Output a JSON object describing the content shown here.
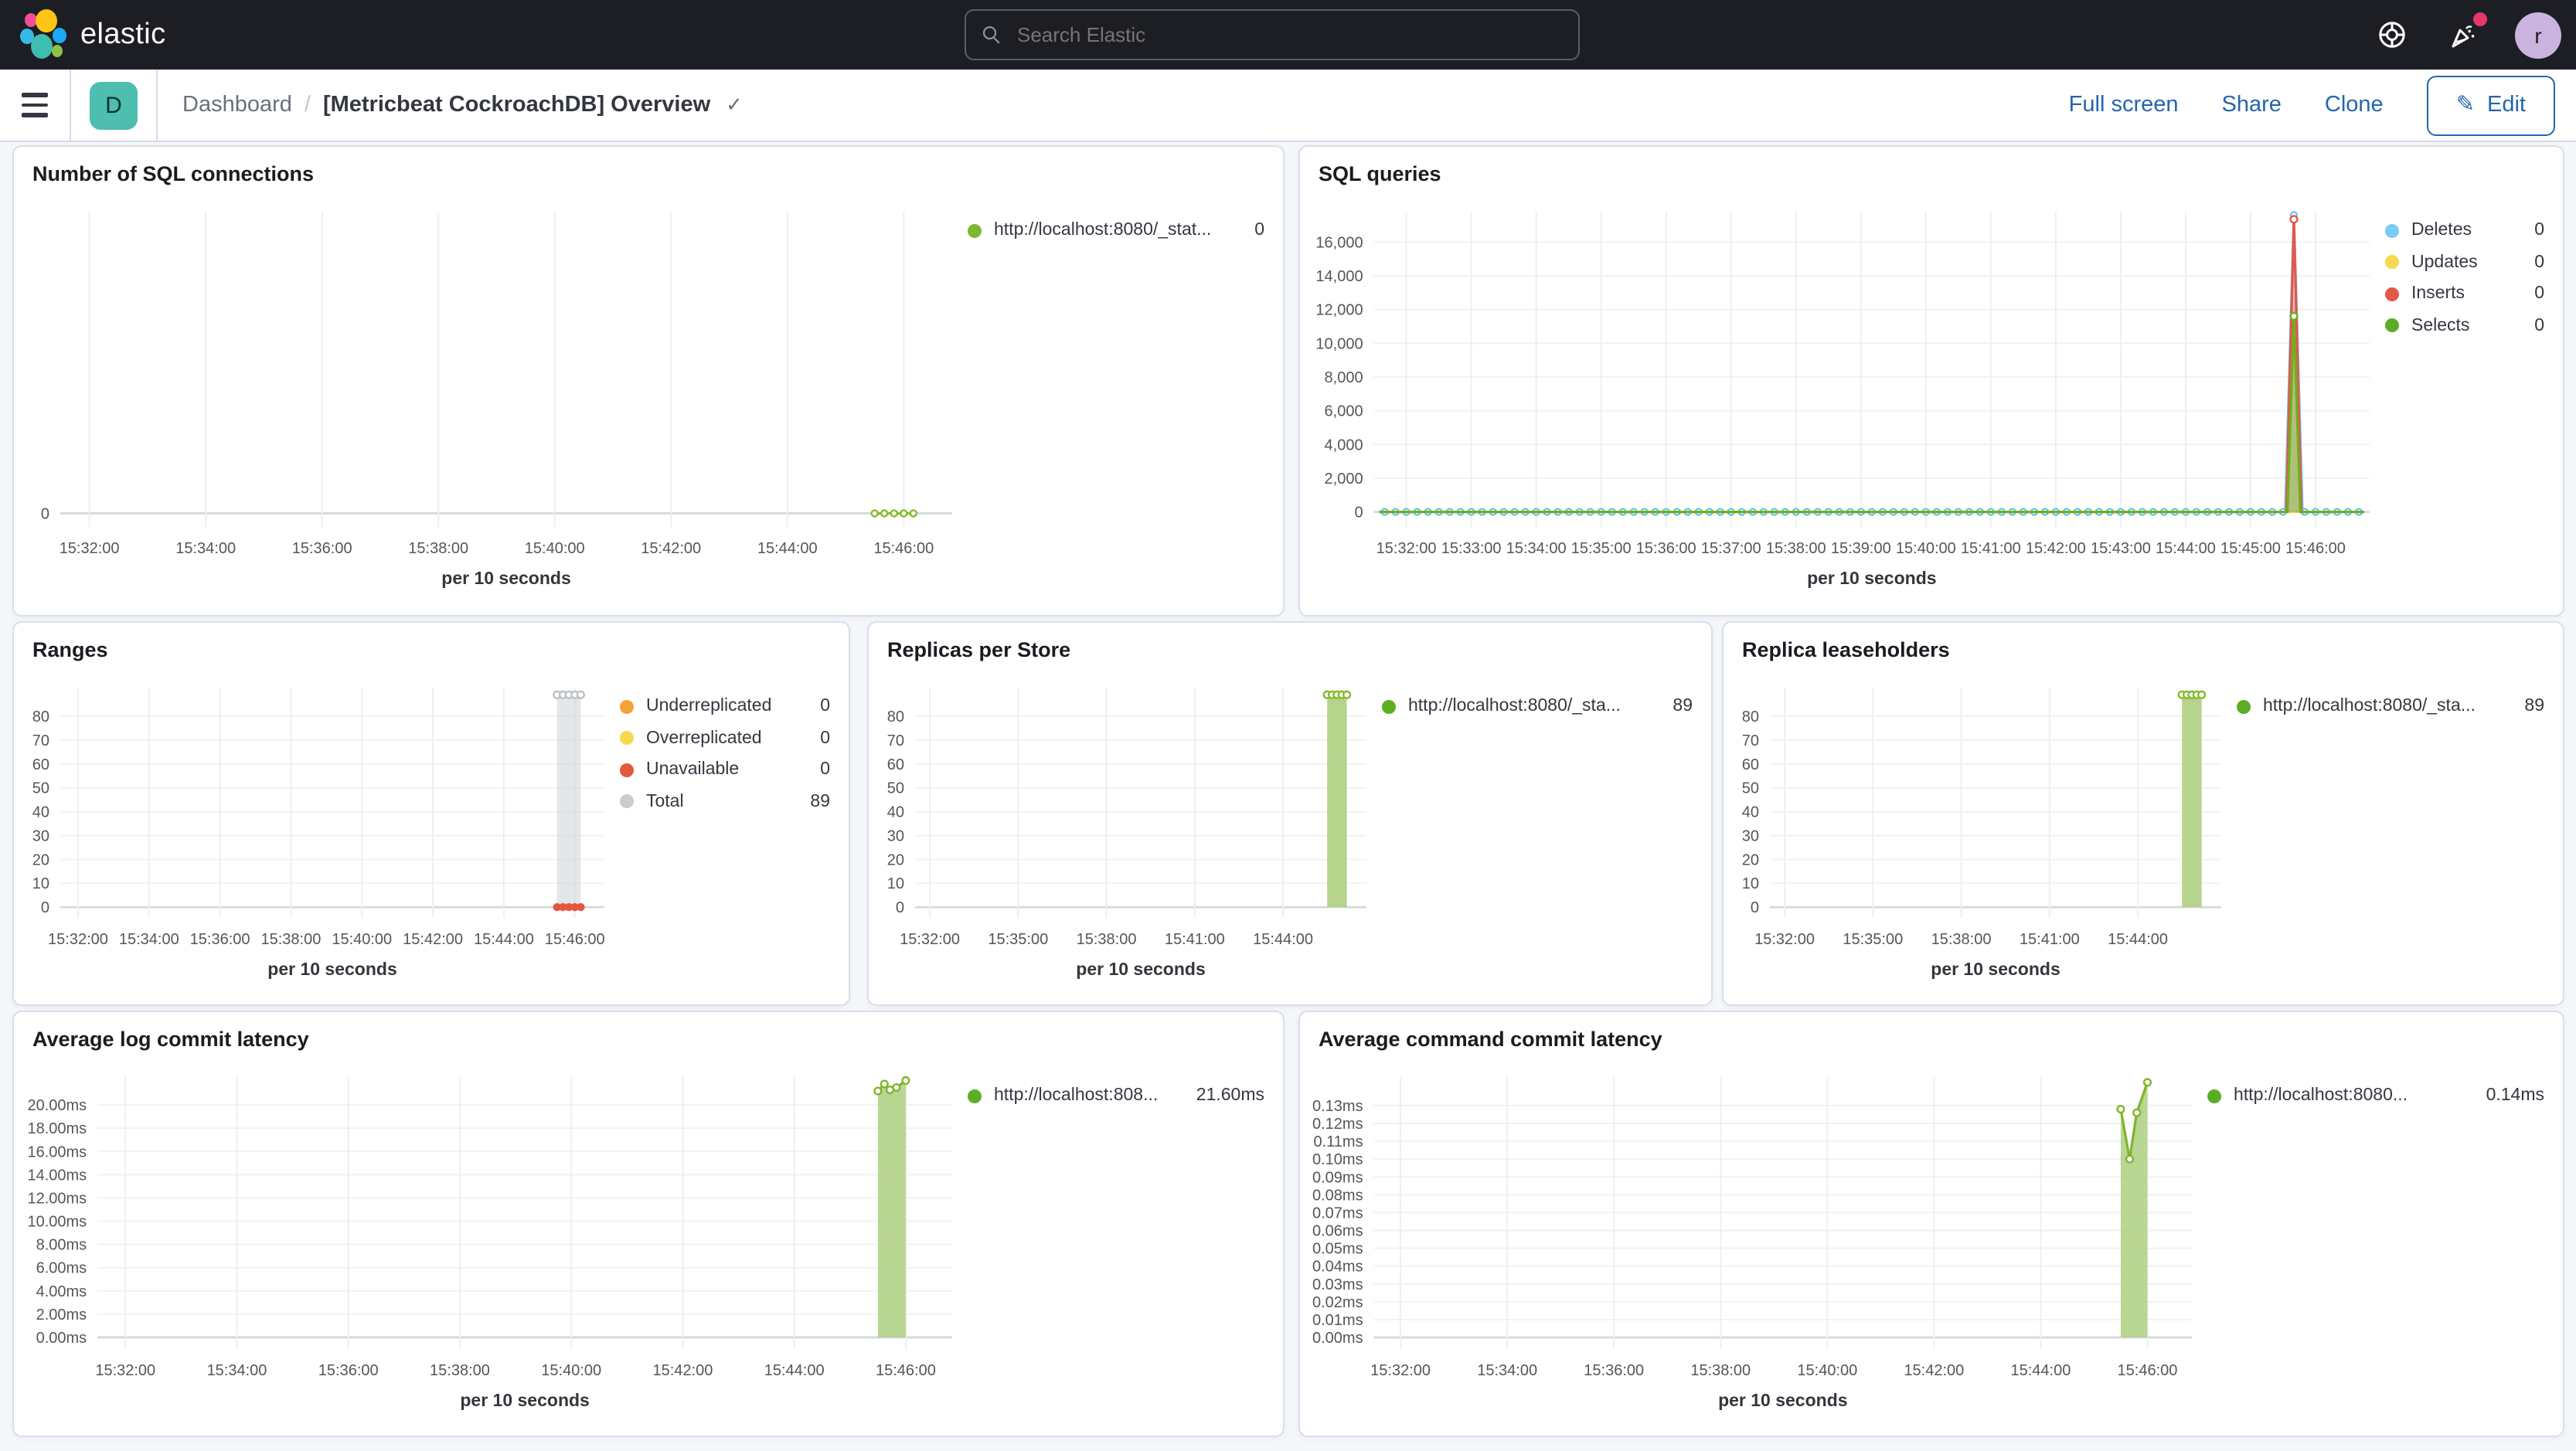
{
  "header": {
    "logo_text": "elastic",
    "search_placeholder": "Search Elastic",
    "help_icon": "lifebuoy-icon",
    "news_icon": "party-popper-icon",
    "avatar_letter": "r"
  },
  "toolbar": {
    "space_badge": "D",
    "breadcrumb_root": "Dashboard",
    "breadcrumb_sep": "/",
    "title": "[Metricbeat CockroachDB] Overview",
    "check_glyph": "✓",
    "actions": [
      "Full screen",
      "Share",
      "Clone"
    ],
    "edit_label": "Edit",
    "edit_icon_glyph": "✎"
  },
  "charts": [
    {
      "type": "line",
      "title": "Number of SQL connections",
      "x_axis": {
        "start": "15:31:30",
        "end": "15:46:50",
        "ticks": [
          "15:32:00",
          "15:34:00",
          "15:36:00",
          "15:38:00",
          "15:40:00",
          "15:42:00",
          "15:44:00",
          "15:46:00"
        ],
        "label": "per 10 seconds"
      },
      "y_axis": {
        "min": -0.045,
        "max": 1,
        "ticks": [
          {
            "v": 0,
            "label": "0"
          }
        ]
      },
      "series": [
        {
          "name": "http://localhost:8080/_stat...",
          "type": "line",
          "color": "#86BB2D",
          "points": [
            [
              "15:45:30",
              0
            ],
            [
              "15:46:10",
              0
            ]
          ],
          "markers": {
            "interval": 10,
            "from": "15:45:30",
            "to": "15:46:10"
          }
        }
      ],
      "legend": [
        {
          "label": "http://localhost:8080/_stat...",
          "value": "0",
          "color": "#7FB733"
        }
      ]
    },
    {
      "type": "area",
      "title": "SQL queries",
      "x_axis": {
        "start": "15:31:30",
        "end": "15:46:50",
        "ticks": [
          "15:32:00",
          "15:33:00",
          "15:34:00",
          "15:35:00",
          "15:36:00",
          "15:37:00",
          "15:38:00",
          "15:39:00",
          "15:40:00",
          "15:41:00",
          "15:42:00",
          "15:43:00",
          "15:44:00",
          "15:45:00",
          "15:46:00"
        ],
        "label": "per 10 seconds"
      },
      "y_axis": {
        "min": -890,
        "max": 17800,
        "ticks": [
          {
            "v": 0,
            "label": "0"
          },
          {
            "v": 2000,
            "label": "2,000"
          },
          {
            "v": 4000,
            "label": "4,000"
          },
          {
            "v": 6000,
            "label": "6,000"
          },
          {
            "v": 8000,
            "label": "8,000"
          },
          {
            "v": 10000,
            "label": "10,000"
          },
          {
            "v": 12000,
            "label": "12,000"
          },
          {
            "v": 14000,
            "label": "14,000"
          },
          {
            "v": 16000,
            "label": "16,000"
          }
        ]
      },
      "series": [
        {
          "name": "Updates",
          "type": "line",
          "color": "#F1D550",
          "points": [
            [
              "15:31:35",
              0
            ],
            [
              "15:46:45",
              0
            ]
          ]
        },
        {
          "name": "Deletes",
          "type": "area",
          "color": "#6EC7EC",
          "fill": "rgba(110,199,236,0.28)",
          "points": [
            [
              "15:31:35",
              0
            ],
            [
              "15:45:32",
              0
            ],
            [
              "15:45:40",
              17600
            ],
            [
              "15:45:48",
              0
            ],
            [
              "15:46:45",
              0
            ]
          ],
          "markers": {
            "interval": 10,
            "from": "15:31:40",
            "to": "15:46:40"
          }
        },
        {
          "name": "Inserts",
          "type": "area",
          "color": "#E4574C",
          "fill": "rgba(228,87,76,0.30)",
          "points": [
            [
              "15:31:35",
              0
            ],
            [
              "15:45:33",
              0
            ],
            [
              "15:45:40",
              17350
            ],
            [
              "15:45:47",
              0
            ],
            [
              "15:46:45",
              0
            ]
          ],
          "markers": "peaks"
        },
        {
          "name": "Selects",
          "type": "area",
          "color": "#6FAF1F",
          "fill": "rgba(140,190,60,0.55)",
          "points": [
            [
              "15:31:35",
              0
            ],
            [
              "15:45:34",
              0
            ],
            [
              "15:45:40",
              11600
            ],
            [
              "15:45:46",
              0
            ],
            [
              "15:46:45",
              0
            ]
          ],
          "markers": "peaks"
        }
      ],
      "legend": [
        {
          "label": "Deletes",
          "value": "0",
          "color": "#79CBF0"
        },
        {
          "label": "Updates",
          "value": "0",
          "color": "#F5D94F"
        },
        {
          "label": "Inserts",
          "value": "0",
          "color": "#E4574C"
        },
        {
          "label": "Selects",
          "value": "0",
          "color": "#5BAE23"
        }
      ]
    },
    {
      "type": "bar",
      "title": "Ranges",
      "x_axis": {
        "start": "15:31:30",
        "end": "15:46:50",
        "ticks": [
          "15:32:00",
          "15:34:00",
          "15:36:00",
          "15:38:00",
          "15:40:00",
          "15:42:00",
          "15:44:00",
          "15:46:00"
        ],
        "label": "per 10 seconds"
      },
      "y_axis": {
        "min": -4.5,
        "max": 92,
        "ticks": [
          {
            "v": 0,
            "label": "0"
          },
          {
            "v": 10,
            "label": "10"
          },
          {
            "v": 20,
            "label": "20"
          },
          {
            "v": 30,
            "label": "30"
          },
          {
            "v": 40,
            "label": "40"
          },
          {
            "v": 50,
            "label": "50"
          },
          {
            "v": 60,
            "label": "60"
          },
          {
            "v": 70,
            "label": "70"
          },
          {
            "v": 80,
            "label": "80"
          }
        ]
      },
      "series": [
        {
          "name": "Total",
          "type": "bar",
          "color": "#BCC0C6",
          "fill": "rgba(203,206,210,0.5)",
          "from": "15:45:30",
          "to": "15:46:10",
          "value": 89,
          "top_markers": true
        },
        {
          "name": "Unavailable",
          "type": "dots",
          "color": "#E4573D",
          "from": "15:45:30",
          "to": "15:46:10",
          "value": 0
        }
      ],
      "legend": [
        {
          "label": "Underreplicated",
          "value": "0",
          "color": "#F2A23A"
        },
        {
          "label": "Overreplicated",
          "value": "0",
          "color": "#F5D94F"
        },
        {
          "label": "Unavailable",
          "value": "0",
          "color": "#E4573D"
        },
        {
          "label": "Total",
          "value": "89",
          "color": "#C9CCD1"
        }
      ]
    },
    {
      "type": "bar",
      "title": "Replicas per Store",
      "x_axis": {
        "start": "15:31:30",
        "end": "15:46:50",
        "ticks": [
          "15:32:00",
          "15:35:00",
          "15:38:00",
          "15:41:00",
          "15:44:00"
        ],
        "label": "per 10 seconds"
      },
      "y_axis": {
        "min": -4.5,
        "max": 92,
        "ticks": [
          {
            "v": 0,
            "label": "0"
          },
          {
            "v": 10,
            "label": "10"
          },
          {
            "v": 20,
            "label": "20"
          },
          {
            "v": 30,
            "label": "30"
          },
          {
            "v": 40,
            "label": "40"
          },
          {
            "v": 50,
            "label": "50"
          },
          {
            "v": 60,
            "label": "60"
          },
          {
            "v": 70,
            "label": "70"
          },
          {
            "v": 80,
            "label": "80"
          }
        ]
      },
      "series": [
        {
          "name": "http://localhost:8080/_sta...",
          "type": "bar",
          "color": "#86BB2D",
          "fill": "rgba(174,207,128,0.9)",
          "from": "15:45:30",
          "to": "15:46:10",
          "value": 89,
          "top_markers": true
        }
      ],
      "legend": [
        {
          "label": "http://localhost:8080/_sta...",
          "value": "89",
          "color": "#5BAE23"
        }
      ]
    },
    {
      "type": "bar",
      "title": "Replica leaseholders",
      "x_axis": {
        "start": "15:31:30",
        "end": "15:46:50",
        "ticks": [
          "15:32:00",
          "15:35:00",
          "15:38:00",
          "15:41:00",
          "15:44:00"
        ],
        "label": "per 10 seconds"
      },
      "y_axis": {
        "min": -4.5,
        "max": 92,
        "ticks": [
          {
            "v": 0,
            "label": "0"
          },
          {
            "v": 10,
            "label": "10"
          },
          {
            "v": 20,
            "label": "20"
          },
          {
            "v": 30,
            "label": "30"
          },
          {
            "v": 40,
            "label": "40"
          },
          {
            "v": 50,
            "label": "50"
          },
          {
            "v": 60,
            "label": "60"
          },
          {
            "v": 70,
            "label": "70"
          },
          {
            "v": 80,
            "label": "80"
          }
        ]
      },
      "series": [
        {
          "name": "http://localhost:8080/_sta...",
          "type": "bar",
          "color": "#86BB2D",
          "fill": "rgba(174,207,128,0.9)",
          "from": "15:45:30",
          "to": "15:46:10",
          "value": 89,
          "top_markers": true
        }
      ],
      "legend": [
        {
          "label": "http://localhost:8080/_sta...",
          "value": "89",
          "color": "#5BAE23"
        }
      ]
    },
    {
      "type": "area",
      "title": "Average log commit latency",
      "x_axis": {
        "start": "15:31:30",
        "end": "15:46:50",
        "ticks": [
          "15:32:00",
          "15:34:00",
          "15:36:00",
          "15:38:00",
          "15:40:00",
          "15:42:00",
          "15:44:00",
          "15:46:00"
        ],
        "label": "per 10 seconds"
      },
      "y_axis": {
        "min": -1.0,
        "max": 22.4,
        "ticks": [
          {
            "v": 0,
            "label": "0.00ms"
          },
          {
            "v": 2,
            "label": "2.00ms"
          },
          {
            "v": 4,
            "label": "4.00ms"
          },
          {
            "v": 6,
            "label": "6.00ms"
          },
          {
            "v": 8,
            "label": "8.00ms"
          },
          {
            "v": 10,
            "label": "10.00ms"
          },
          {
            "v": 12,
            "label": "12.00ms"
          },
          {
            "v": 14,
            "label": "14.00ms"
          },
          {
            "v": 16,
            "label": "16.00ms"
          },
          {
            "v": 18,
            "label": "18.00ms"
          },
          {
            "v": 20,
            "label": "20.00ms"
          }
        ]
      },
      "series": [
        {
          "name": "http://localhost:808...",
          "type": "area",
          "color": "#7FB62A",
          "fill": "rgba(174,207,128,0.85)",
          "points": [
            [
              "15:45:30",
              21.2
            ],
            [
              "15:45:37",
              21.8
            ],
            [
              "15:45:43",
              21.3
            ],
            [
              "15:45:50",
              21.5
            ],
            [
              "15:46:00",
              22.1
            ]
          ],
          "markers": "all"
        }
      ],
      "legend": [
        {
          "label": "http://localhost:808...",
          "value": "21.60ms",
          "color": "#5BAE23"
        }
      ]
    },
    {
      "type": "area",
      "title": "Average command commit latency",
      "x_axis": {
        "start": "15:31:30",
        "end": "15:46:50",
        "ticks": [
          "15:32:00",
          "15:34:00",
          "15:36:00",
          "15:38:00",
          "15:40:00",
          "15:42:00",
          "15:44:00",
          "15:46:00"
        ],
        "label": "per 10 seconds"
      },
      "y_axis": {
        "min": -0.0065,
        "max": 0.146,
        "ticks": [
          {
            "v": 0,
            "label": "0.00ms"
          },
          {
            "v": 0.01,
            "label": "0.01ms"
          },
          {
            "v": 0.02,
            "label": "0.02ms"
          },
          {
            "v": 0.03,
            "label": "0.03ms"
          },
          {
            "v": 0.04,
            "label": "0.04ms"
          },
          {
            "v": 0.05,
            "label": "0.05ms"
          },
          {
            "v": 0.06,
            "label": "0.06ms"
          },
          {
            "v": 0.07,
            "label": "0.07ms"
          },
          {
            "v": 0.08,
            "label": "0.08ms"
          },
          {
            "v": 0.09,
            "label": "0.09ms"
          },
          {
            "v": 0.1,
            "label": "0.10ms"
          },
          {
            "v": 0.11,
            "label": "0.11ms"
          },
          {
            "v": 0.12,
            "label": "0.12ms"
          },
          {
            "v": 0.13,
            "label": "0.13ms"
          }
        ]
      },
      "series": [
        {
          "name": "http://localhost:8080...",
          "type": "area",
          "color": "#7FB62A",
          "fill": "rgba(174,207,128,0.85)",
          "points": [
            [
              "15:45:30",
              0.128
            ],
            [
              "15:45:40",
              0.1
            ],
            [
              "15:45:48",
              0.126
            ],
            [
              "15:46:00",
              0.143
            ]
          ],
          "markers": "all"
        }
      ],
      "legend": [
        {
          "label": "http://localhost:8080...",
          "value": "0.14ms",
          "color": "#5BAE23"
        }
      ]
    }
  ]
}
